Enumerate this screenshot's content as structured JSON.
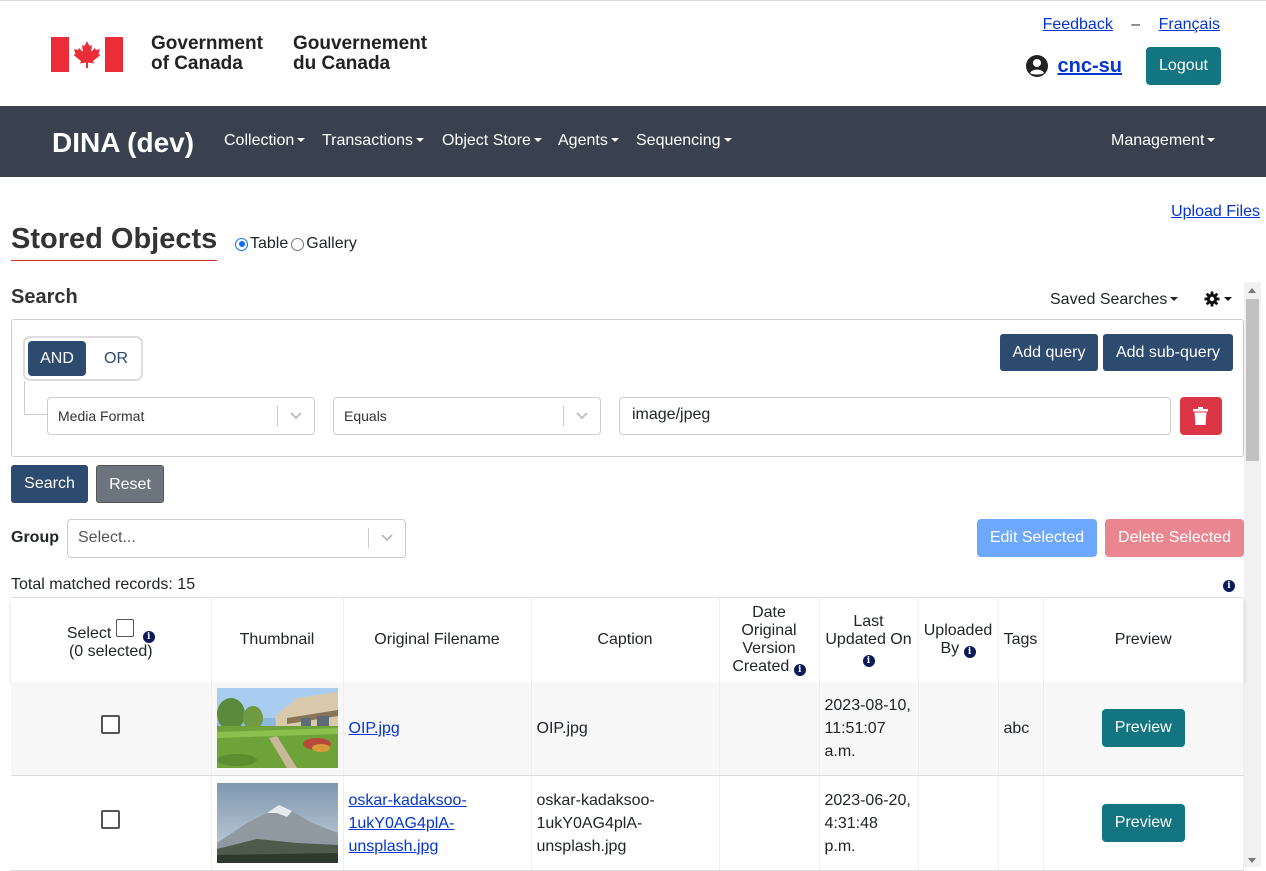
{
  "header": {
    "wordmark_en_line1": "Government",
    "wordmark_en_line2": "of Canada",
    "wordmark_fr_line1": "Gouvernement",
    "wordmark_fr_line2": "du Canada",
    "feedback_link": "Feedback",
    "separator": "–",
    "language_link": "Français",
    "username": "cnc-su",
    "logout_label": "Logout"
  },
  "navbar": {
    "brand": "DINA (dev)",
    "items": [
      "Collection",
      "Transactions",
      "Object Store",
      "Agents",
      "Sequencing"
    ],
    "right_item": "Management"
  },
  "page": {
    "upload_link": "Upload Files",
    "title": "Stored Objects",
    "view_table": "Table",
    "view_gallery": "Gallery",
    "view_selected": "Table"
  },
  "search": {
    "heading": "Search",
    "saved_searches": "Saved Searches",
    "and_label": "AND",
    "or_label": "OR",
    "add_query": "Add query",
    "add_subquery": "Add sub-query",
    "field": "Media Format",
    "operator": "Equals",
    "value": "image/jpeg",
    "search_button": "Search",
    "reset_button": "Reset"
  },
  "group": {
    "label": "Group",
    "placeholder": "Select..."
  },
  "actions": {
    "edit_selected": "Edit Selected",
    "delete_selected": "Delete Selected"
  },
  "results": {
    "total_label": "Total matched records: 15"
  },
  "table": {
    "select_header": "Select",
    "selected_count": "(0 selected)",
    "headers": {
      "thumbnail": "Thumbnail",
      "filename": "Original Filename",
      "caption": "Caption",
      "date_created_1": "Date",
      "date_created_2": "Original",
      "date_created_3": "Version",
      "date_created_4": "Created",
      "last_updated_1": "Last",
      "last_updated_2": "Updated On",
      "uploaded_by_1": "Uploaded",
      "uploaded_by_2": "By",
      "tags": "Tags",
      "preview": "Preview"
    },
    "rows": [
      {
        "filename": "OIP.jpg",
        "caption": "OIP.jpg",
        "date_created": "",
        "updated_1": "2023-08-10,",
        "updated_2": "11:51:07",
        "updated_3": "a.m.",
        "uploaded_by": "",
        "tags": "abc",
        "preview": "Preview"
      },
      {
        "filename_1": "oskar-kadaksoo-",
        "filename_2": "1ukY0AG4plA-",
        "filename_3": "unsplash.jpg",
        "caption_1": "oskar-kadaksoo-",
        "caption_2": "1ukY0AG4plA-",
        "caption_3": "unsplash.jpg",
        "date_created": "",
        "updated_1": "2023-06-20,",
        "updated_2": "4:31:48",
        "updated_3": "p.m.",
        "uploaded_by": "",
        "tags": "",
        "preview": "Preview"
      }
    ]
  },
  "colors": {
    "navbar_bg": "#38414d",
    "primary_dark": "#2d4a6f",
    "teal": "#137580",
    "danger": "#dc3545",
    "link": "#0535d2"
  }
}
